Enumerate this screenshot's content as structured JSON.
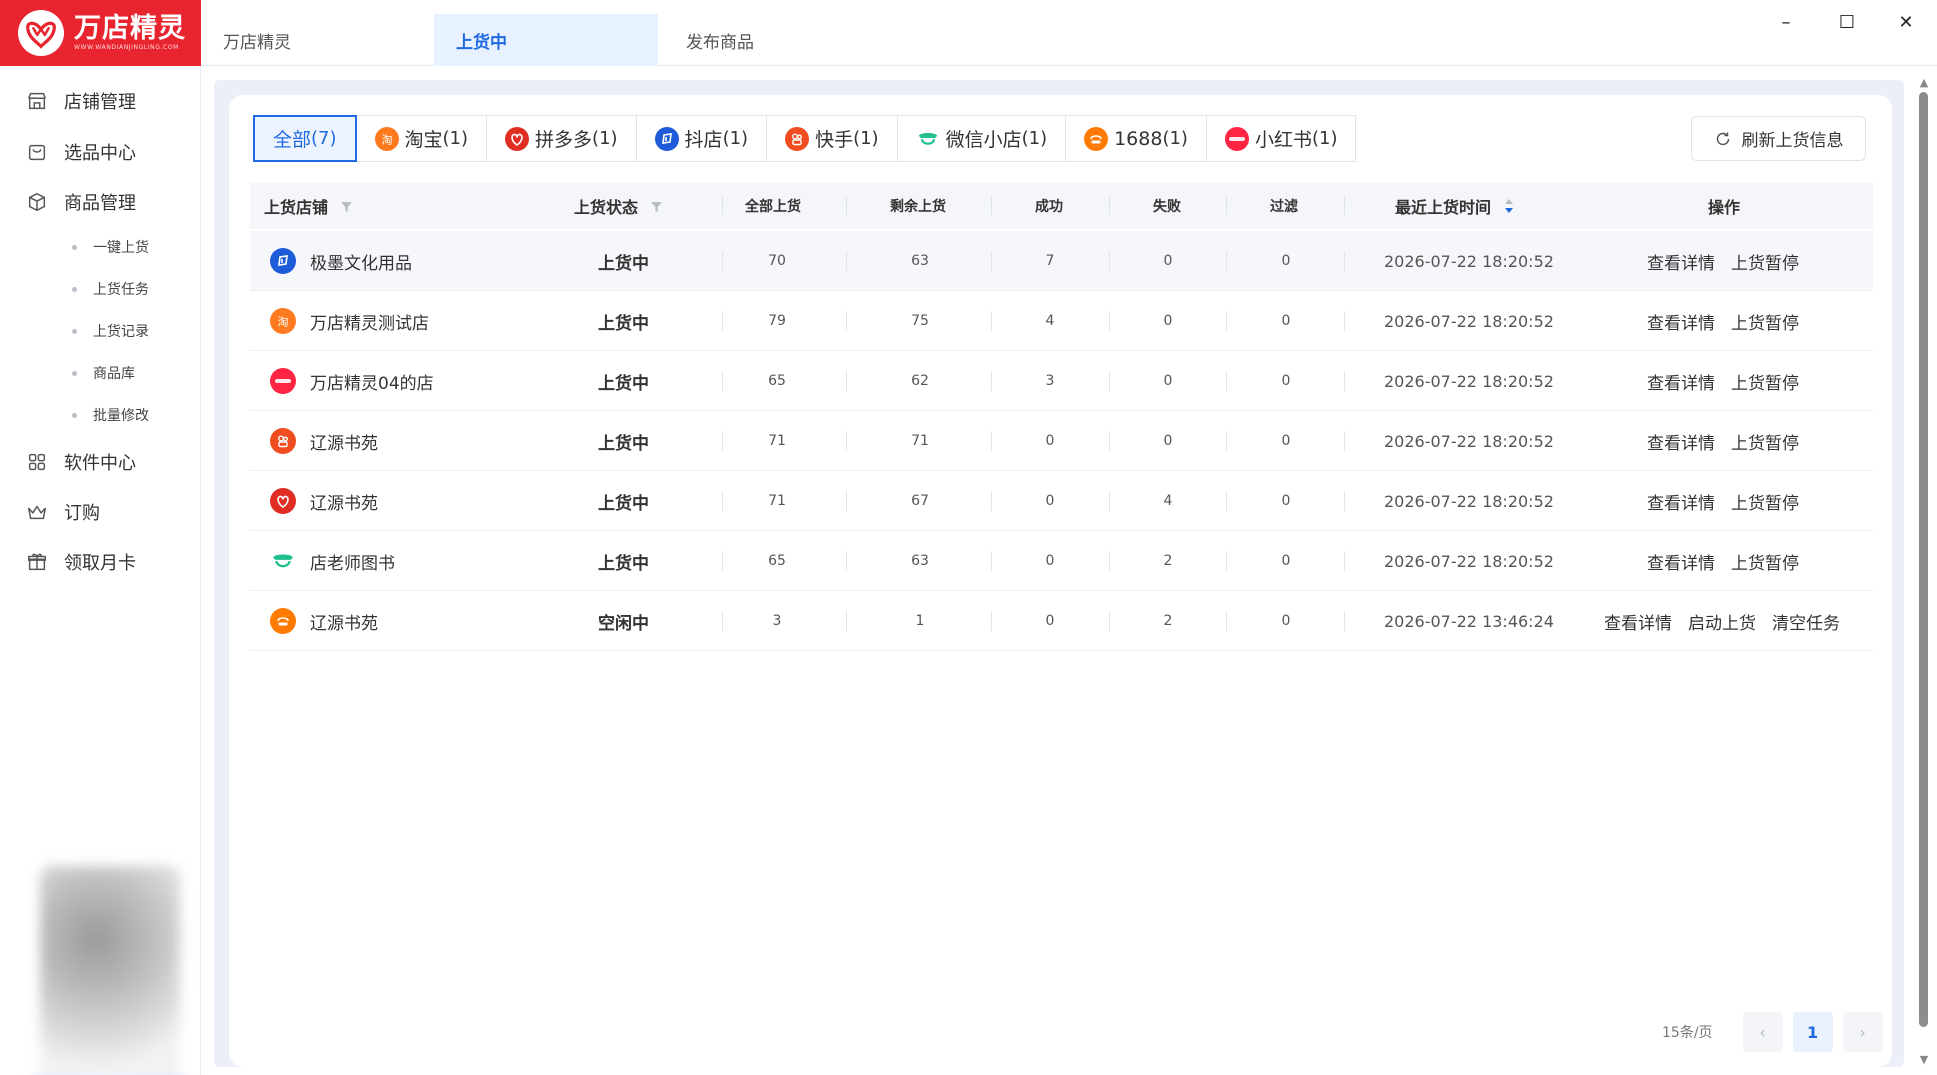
{
  "app": {
    "logo_title": "万店精灵",
    "logo_sub": "WWW.WANDIANJINGLING.COM",
    "brand_color": "#e8242f",
    "accent_color": "#1f6ae0"
  },
  "tabs": [
    {
      "label": "万店精灵",
      "active": false
    },
    {
      "label": "上货中",
      "active": true
    },
    {
      "label": "发布商品",
      "active": false
    }
  ],
  "window_controls": {
    "minimize": "–",
    "maximize": "☐",
    "close": "✕"
  },
  "sidebar": {
    "items": [
      {
        "label": "店铺管理",
        "icon": "store-icon"
      },
      {
        "label": "选品中心",
        "icon": "bag-icon"
      },
      {
        "label": "商品管理",
        "icon": "box-icon"
      }
    ],
    "sub_items": [
      "一键上货",
      "上货任务",
      "上货记录",
      "商品库",
      "批量修改"
    ],
    "items2": [
      {
        "label": "软件中心",
        "icon": "grid-icon"
      },
      {
        "label": "订购",
        "icon": "crown-icon"
      },
      {
        "label": "领取月卡",
        "icon": "gift-icon"
      }
    ]
  },
  "filters": [
    {
      "label": "全部",
      "count": "(7)",
      "active": true,
      "icon": "none"
    },
    {
      "label": "淘宝",
      "count": "(1)",
      "active": false,
      "icon": "taobao-icon"
    },
    {
      "label": "拼多多",
      "count": "(1)",
      "active": false,
      "icon": "pinduoduo-icon"
    },
    {
      "label": "抖店",
      "count": "(1)",
      "active": false,
      "icon": "doudian-icon"
    },
    {
      "label": "快手",
      "count": "(1)",
      "active": false,
      "icon": "kuaishou-icon"
    },
    {
      "label": "微信小店",
      "count": "(1)",
      "active": false,
      "icon": "wechat-shop-icon"
    },
    {
      "label": "1688",
      "count": "(1)",
      "active": false,
      "icon": "1688-icon"
    },
    {
      "label": "小红书",
      "count": "(1)",
      "active": false,
      "icon": "xiaohongshu-icon"
    }
  ],
  "refresh_label": "刷新上货信息",
  "table": {
    "headers": {
      "shop": "上货店铺",
      "status": "上货状态",
      "total": "全部上货",
      "remaining": "剩余上货",
      "success": "成功",
      "failed": "失败",
      "filtered": "过滤",
      "time": "最近上货时间",
      "ops": "操作"
    },
    "rows": [
      {
        "platform": "doudian",
        "shop": "极墨文化用品",
        "status": "上货中",
        "total": "70",
        "remaining": "63",
        "success": "7",
        "failed": "0",
        "filtered": "0",
        "time": "2026-07-22 18:20:52",
        "ops": [
          "查看详情",
          "上货暂停"
        ]
      },
      {
        "platform": "taobao",
        "shop": "万店精灵测试店",
        "status": "上货中",
        "total": "79",
        "remaining": "75",
        "success": "4",
        "failed": "0",
        "filtered": "0",
        "time": "2026-07-22 18:20:52",
        "ops": [
          "查看详情",
          "上货暂停"
        ]
      },
      {
        "platform": "xiaohongshu",
        "shop": "万店精灵04的店",
        "status": "上货中",
        "total": "65",
        "remaining": "62",
        "success": "3",
        "failed": "0",
        "filtered": "0",
        "time": "2026-07-22 18:20:52",
        "ops": [
          "查看详情",
          "上货暂停"
        ]
      },
      {
        "platform": "kuaishou",
        "shop": "辽源书苑",
        "status": "上货中",
        "total": "71",
        "remaining": "71",
        "success": "0",
        "failed": "0",
        "filtered": "0",
        "time": "2026-07-22 18:20:52",
        "ops": [
          "查看详情",
          "上货暂停"
        ]
      },
      {
        "platform": "pinduoduo",
        "shop": "辽源书苑",
        "status": "上货中",
        "total": "71",
        "remaining": "67",
        "success": "0",
        "failed": "4",
        "filtered": "0",
        "time": "2026-07-22 18:20:52",
        "ops": [
          "查看详情",
          "上货暂停"
        ]
      },
      {
        "platform": "wechat",
        "shop": "店老师图书",
        "status": "上货中",
        "total": "65",
        "remaining": "63",
        "success": "0",
        "failed": "2",
        "filtered": "0",
        "time": "2026-07-22 18:20:52",
        "ops": [
          "查看详情",
          "上货暂停"
        ]
      },
      {
        "platform": "1688",
        "shop": "辽源书苑",
        "status": "空闲中",
        "total": "3",
        "remaining": "1",
        "success": "0",
        "failed": "2",
        "filtered": "0",
        "time": "2026-07-22 13:46:24",
        "ops": [
          "查看详情",
          "启动上货",
          "清空任务"
        ]
      }
    ]
  },
  "pagination": {
    "page_size": "15条/页",
    "current": "1",
    "prev": "‹",
    "next": "›"
  },
  "platform_colors": {
    "taobao": "#ff7a1f",
    "pinduoduo": "#e02e24",
    "doudian": "#1e5bd8",
    "kuaishou": "#f04c20",
    "wechat": "#1fbf8f",
    "1688": "#ff7a00",
    "xiaohongshu": "#ff2442"
  }
}
